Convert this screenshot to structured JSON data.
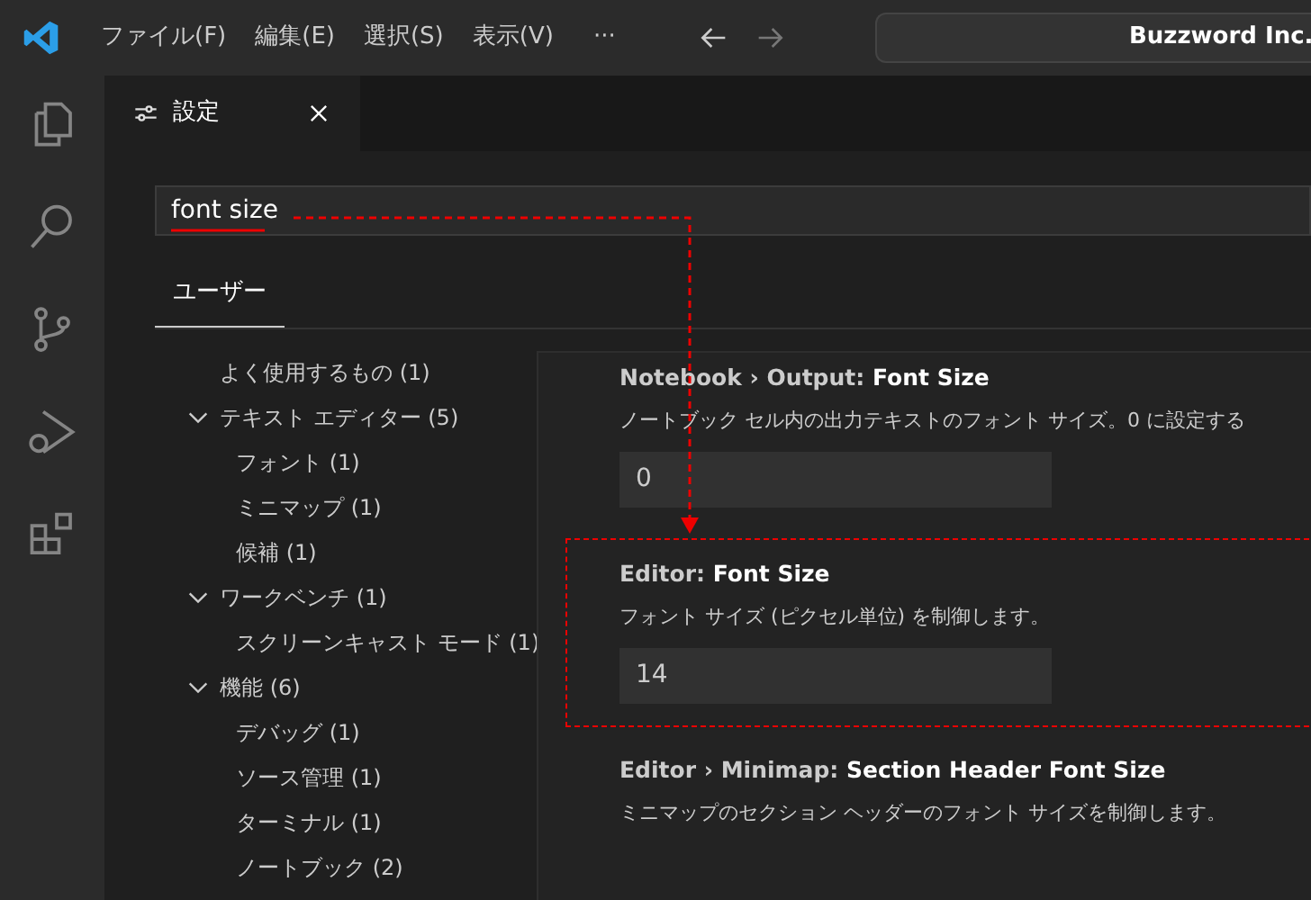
{
  "title_bar": {
    "menus": [
      "ファイル(F)",
      "編集(E)",
      "選択(S)",
      "表示(V)"
    ],
    "more": "···",
    "command_center": "Buzzword Inc."
  },
  "activity_bar": [
    {
      "kind": "files"
    },
    {
      "kind": "search"
    },
    {
      "kind": "source-control"
    },
    {
      "kind": "run-debug"
    },
    {
      "kind": "extensions"
    }
  ],
  "tabs": [
    {
      "label": "設定",
      "selected": true
    }
  ],
  "search": {
    "value": "font size"
  },
  "scope_tabs": [
    {
      "label": "ユーザー",
      "selected": true
    }
  ],
  "toc": [
    {
      "label": "よく使用するもの (1)"
    },
    {
      "label": "テキスト エディター (5)",
      "expanded": true,
      "children": [
        {
          "label": "フォント (1)"
        },
        {
          "label": "ミニマップ (1)"
        },
        {
          "label": "候補 (1)"
        }
      ]
    },
    {
      "label": "ワークベンチ (1)",
      "expanded": true,
      "children": [
        {
          "label": "スクリーンキャスト モード (1)"
        }
      ]
    },
    {
      "label": "機能 (6)",
      "expanded": true,
      "children": [
        {
          "label": "デバッグ (1)"
        },
        {
          "label": "ソース管理 (1)"
        },
        {
          "label": "ターミナル (1)"
        },
        {
          "label": "ノートブック (2)"
        }
      ]
    }
  ],
  "settings": [
    {
      "category": "Notebook › Output: ",
      "title": "Font Size",
      "description": "ノートブック セル内の出力テキストのフォント サイズ。0 に設定する",
      "value": "0",
      "highlighted": false
    },
    {
      "category": "Editor: ",
      "title": "Font Size",
      "description": "フォント サイズ (ピクセル単位) を制御します。",
      "value": "14",
      "highlighted": true
    },
    {
      "category": "Editor › Minimap: ",
      "title": "Section Header Font Size",
      "description": "ミニマップのセクション ヘッダーのフォント サイズを制御します。",
      "highlighted": false
    }
  ]
}
